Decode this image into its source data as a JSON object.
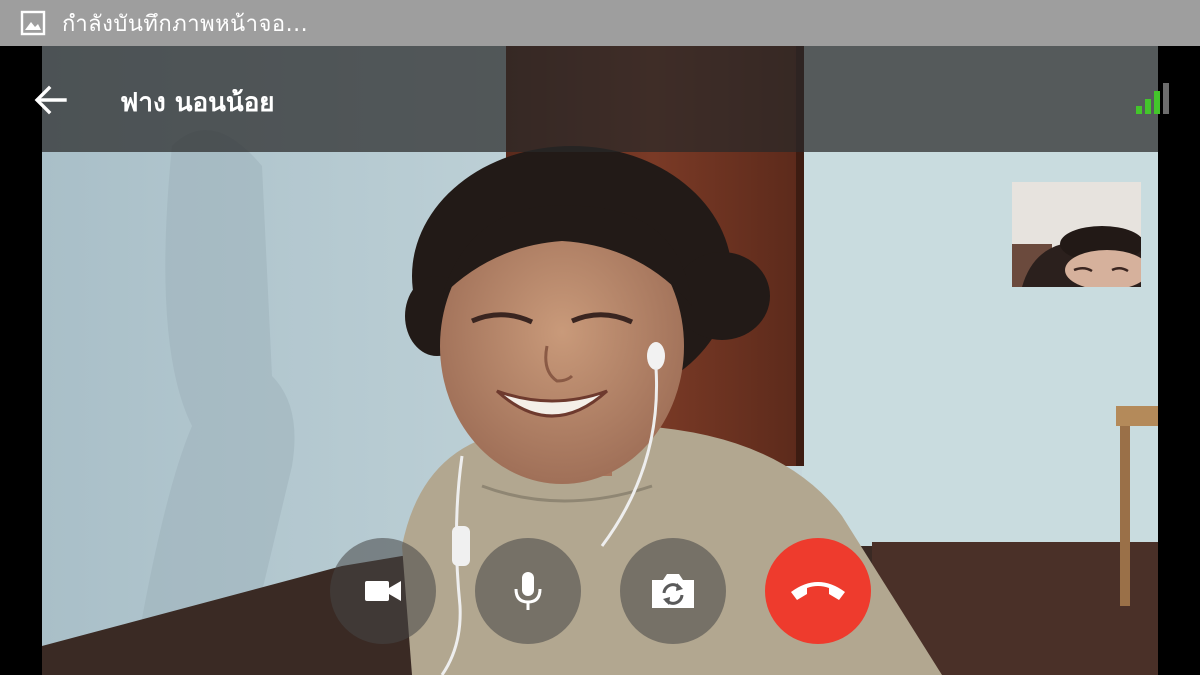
{
  "status_bar": {
    "text": "กำลังบันทึกภาพหน้าจอ...",
    "icon": "image-icon"
  },
  "call_header": {
    "contact_name": "ฟาง นอนน้อย",
    "back_icon": "arrow-back-icon",
    "signal_icon": "signal-strength-icon"
  },
  "controls": [
    {
      "name": "camera-toggle-button",
      "icon": "videocam-icon"
    },
    {
      "name": "mute-button",
      "icon": "microphone-icon"
    },
    {
      "name": "switch-camera-button",
      "icon": "camera-switch-icon"
    },
    {
      "name": "end-call-button",
      "icon": "phone-hangup-icon"
    }
  ],
  "colors": {
    "status_bar_bg": "#9e9e9e",
    "header_overlay": "rgba(40,40,40,0.72)",
    "signal_green": "#43c62b",
    "end_call_red": "#ee3b2d",
    "control_bg": "rgba(70,70,70,0.55)"
  }
}
